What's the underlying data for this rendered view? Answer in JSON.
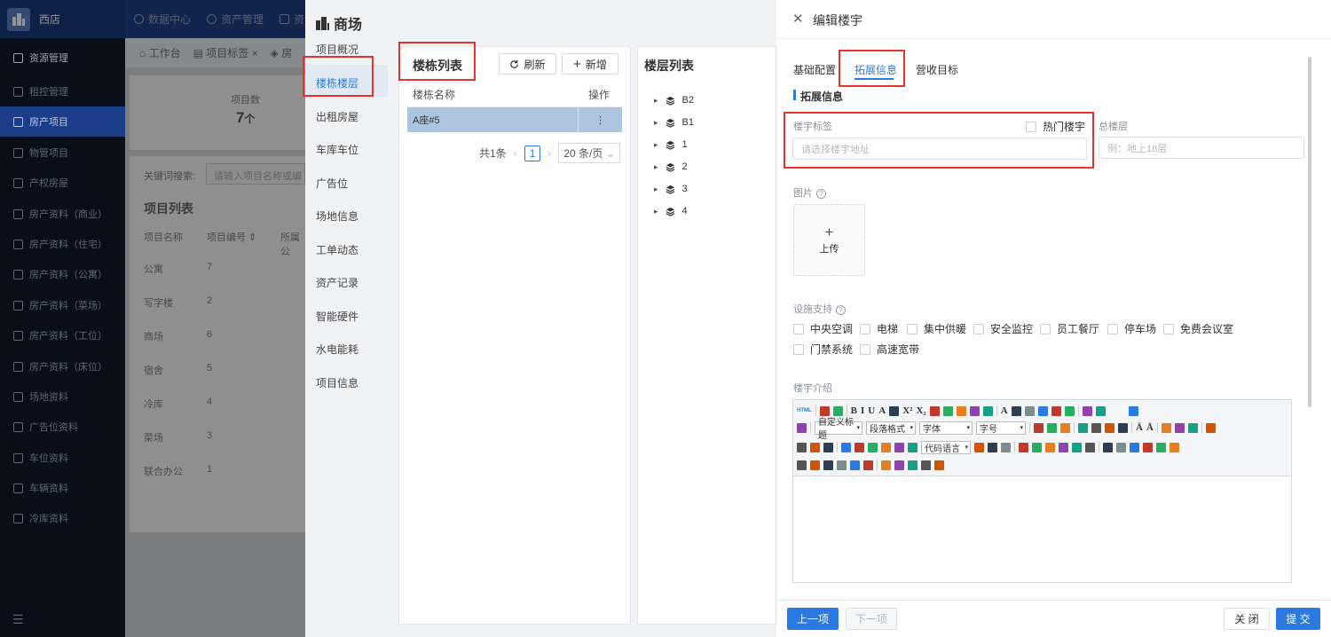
{
  "brand": {
    "name": "西店"
  },
  "sidebar": {
    "items": [
      {
        "label": "资源管理",
        "icon": "building-icon"
      },
      {
        "label": "租控管理",
        "icon": "home-icon"
      },
      {
        "label": "房产项目",
        "icon": "layers-icon"
      },
      {
        "label": "物管项目",
        "icon": "building-icon"
      },
      {
        "label": "产权房屋",
        "icon": "layers-icon"
      },
      {
        "label": "房产资料（商业）",
        "icon": "shop-icon"
      },
      {
        "label": "房产资料（住宅）",
        "icon": "house-icon"
      },
      {
        "label": "房产资料（公寓）",
        "icon": "apartment-icon"
      },
      {
        "label": "房产资料（菜场）",
        "icon": "market-icon"
      },
      {
        "label": "房产资料（工位）",
        "icon": "desk-icon"
      },
      {
        "label": "房产资料（床位）",
        "icon": "bed-icon"
      },
      {
        "label": "场地资料",
        "icon": "field-icon"
      },
      {
        "label": "广告位资料",
        "icon": "ad-icon"
      },
      {
        "label": "车位资料",
        "icon": "parking-icon"
      },
      {
        "label": "车辆资料",
        "icon": "car-icon"
      },
      {
        "label": "冷库资料",
        "icon": "cold-storage-icon"
      }
    ]
  },
  "topnav": {
    "items": [
      "数据中心",
      "资产管理",
      "资"
    ]
  },
  "tabs": {
    "items": [
      "工作台",
      "项目标签",
      "房"
    ]
  },
  "stats": {
    "label": "项目数",
    "value": "7",
    "unit": "个"
  },
  "search": {
    "label": "关键词搜索:",
    "placeholder": "请输入项目名称或编"
  },
  "project_list": {
    "title": "项目列表",
    "headers": [
      "项目名称",
      "项目编号",
      "所属公"
    ],
    "rows": [
      [
        "公寓",
        "7"
      ],
      [
        "写字楼",
        "2"
      ],
      [
        "商场",
        "6"
      ],
      [
        "宿舍",
        "5"
      ],
      [
        "冷库",
        "4"
      ],
      [
        "菜场",
        "3"
      ],
      [
        "联合办公",
        "1"
      ]
    ]
  },
  "middle": {
    "title": "商场",
    "nav": [
      "项目概况",
      "楼栋楼层",
      "出租房屋",
      "车库车位",
      "广告位",
      "场地信息",
      "工单动态",
      "资产记录",
      "智能硬件",
      "水电能耗",
      "项目信息"
    ],
    "building_list": {
      "title": "楼栋列表",
      "refresh": "刷新",
      "add": "新增",
      "col_name": "楼栋名称",
      "col_action": "操作",
      "rows": [
        {
          "name": "A座#5",
          "action": "⋮"
        }
      ],
      "total": "共1条",
      "page": "1",
      "page_size": "20 条/页"
    },
    "floor_list": {
      "title": "楼层列表",
      "floors": [
        "B2",
        "B1",
        "1",
        "2",
        "3",
        "4"
      ]
    }
  },
  "drawer": {
    "title": "编辑楼宇",
    "tabs": [
      "基础配置",
      "拓展信息",
      "营收目标"
    ],
    "section": "拓展信息",
    "tag_label": "楼宇标签",
    "hot_label": "热门楼宇",
    "tag_placeholder": "请选择楼宇地址",
    "floors_label": "总楼层",
    "floors_placeholder": "例：地上18层",
    "image_label": "图片",
    "upload_label": "上传",
    "facilities_label": "设施支持",
    "facilities": [
      "中央空调",
      "电梯",
      "集中供暖",
      "安全监控",
      "员工餐厅",
      "停车场",
      "免费会议室",
      "门禁系统",
      "高速宽带"
    ],
    "intro_label": "楼宇介绍",
    "editor": {
      "html_label": "HTML",
      "heading_select": "自定义标题",
      "paragraph_select": "段落格式",
      "font_select": "字体",
      "size_select": "字号",
      "code_select": "代码语言"
    },
    "footer": {
      "prev": "上一项",
      "next": "下一项",
      "close": "关 闭",
      "submit": "提 交"
    }
  },
  "colors": {
    "primary": "#2a7ae2",
    "highlight": "#e8312c",
    "sidebar": "#0f1a2a",
    "sidebar_active": "#1c3e8a"
  }
}
